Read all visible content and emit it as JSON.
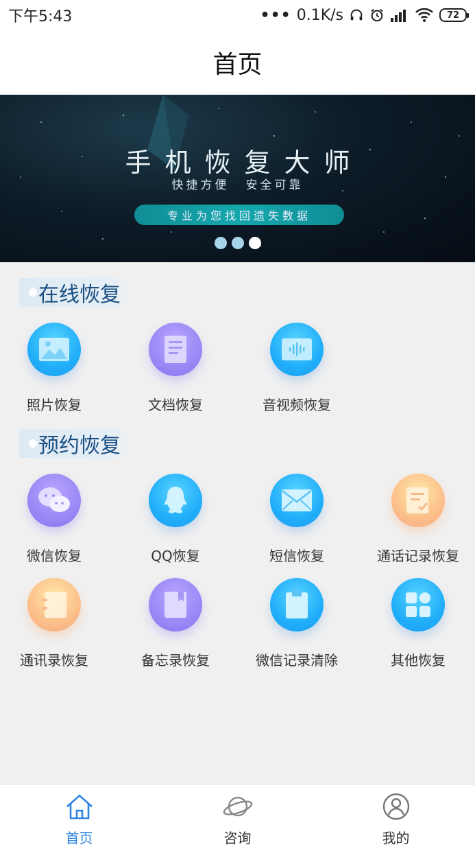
{
  "status_bar": {
    "time": "下午5:43",
    "more": "•••",
    "network_speed": "0.1K/s",
    "battery": "72"
  },
  "header": {
    "title": "首页"
  },
  "banner": {
    "title": "手机恢复大师",
    "subtitle_left": "快捷方便",
    "subtitle_right": "安全可靠",
    "pill": "专业为您找回遗失数据",
    "active_dot": 2
  },
  "online_section": {
    "title": "在线恢复",
    "items": [
      {
        "label": "照片恢复",
        "icon": "photo-icon"
      },
      {
        "label": "文档恢复",
        "icon": "document-icon"
      },
      {
        "label": "音视频恢复",
        "icon": "audio-video-icon"
      }
    ]
  },
  "reserve_section": {
    "title": "预约恢复",
    "items": [
      {
        "label": "微信恢复",
        "icon": "wechat-icon"
      },
      {
        "label": "QQ恢复",
        "icon": "qq-icon"
      },
      {
        "label": "短信恢复",
        "icon": "sms-icon"
      },
      {
        "label": "通话记录恢复",
        "icon": "call-log-icon"
      },
      {
        "label": "通讯录恢复",
        "icon": "contacts-icon"
      },
      {
        "label": "备忘录恢复",
        "icon": "memo-icon"
      },
      {
        "label": "微信记录清除",
        "icon": "wechat-clear-icon"
      },
      {
        "label": "其他恢复",
        "icon": "other-icon"
      }
    ]
  },
  "bottom_nav": {
    "items": [
      {
        "label": "首页",
        "icon": "home-icon",
        "active": true
      },
      {
        "label": "咨询",
        "icon": "planet-icon",
        "active": false
      },
      {
        "label": "我的",
        "icon": "user-icon",
        "active": false
      }
    ]
  },
  "colors": {
    "accent": "#2f86e0",
    "section_title": "#1a4f82",
    "page_bg": "#f0f0f0"
  }
}
